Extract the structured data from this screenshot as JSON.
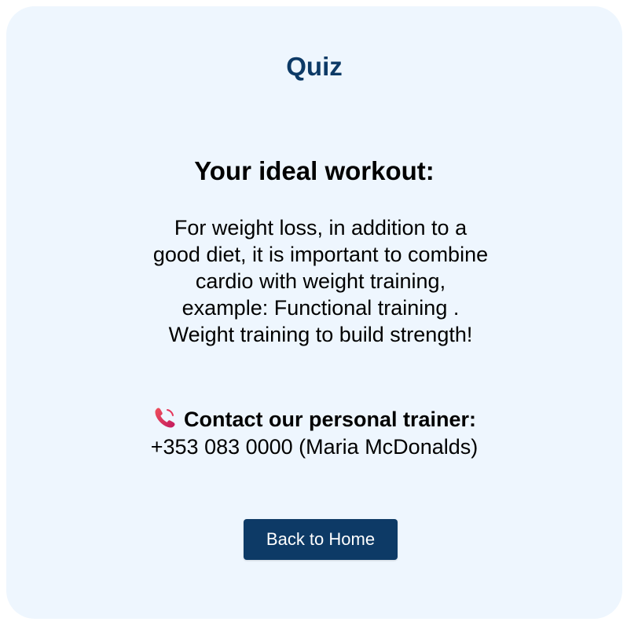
{
  "page": {
    "title": "Quiz"
  },
  "result": {
    "heading": "Your ideal workout:",
    "description": "For weight loss, in addition to a good diet, it is important to combine cardio with weight training, example: Functional training . Weight training to build strength!"
  },
  "contact": {
    "icon": "phone-icon",
    "label": "Contact our personal trainer:",
    "phone": "+353 083 0000 (Maria McDonalds)"
  },
  "navigation": {
    "back_label": "Back to Home"
  },
  "colors": {
    "card_background": "#eef6fe",
    "accent": "#0d3a66",
    "phone_icon": "#e5355a"
  }
}
